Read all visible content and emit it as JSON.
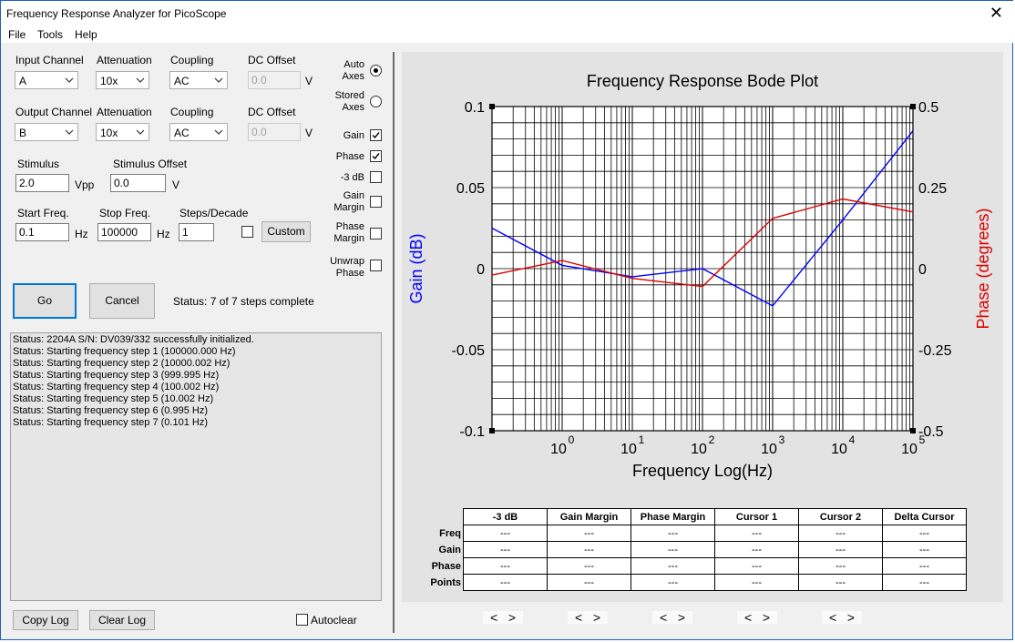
{
  "window": {
    "title": "Frequency Response Analyzer for PicoScope",
    "close": "✕"
  },
  "menu": [
    "File",
    "Tools",
    "Help"
  ],
  "input": {
    "channel_label": "Input Channel",
    "channel": "A",
    "atten_label": "Attenuation",
    "atten": "10x",
    "coupling_label": "Coupling",
    "coupling": "AC",
    "dc_label": "DC Offset",
    "dc": "0.0",
    "dc_unit": "V"
  },
  "output": {
    "channel_label": "Output Channel",
    "channel": "B",
    "atten_label": "Attenuation",
    "atten": "10x",
    "coupling_label": "Coupling",
    "coupling": "AC",
    "dc_label": "DC Offset",
    "dc": "0.0",
    "dc_unit": "V"
  },
  "stimulus": {
    "label": "Stimulus",
    "value": "2.0",
    "unit": "Vpp",
    "offset_label": "Stimulus Offset",
    "offset": "0.0",
    "offset_unit": "V"
  },
  "sweep": {
    "start_label": "Start Freq.",
    "start": "0.1",
    "start_unit": "Hz",
    "stop_label": "Stop Freq.",
    "stop": "100000",
    "stop_unit": "Hz",
    "steps_label": "Steps/Decade",
    "steps": "1",
    "custom_label": "Custom"
  },
  "actions": {
    "go": "Go",
    "cancel": "Cancel",
    "status": "Status:  7 of 7 steps complete"
  },
  "log": [
    "Status: 2204A S/N: DV039/332 successfully initialized.",
    "Status: Starting frequency step 1 (100000.000 Hz)",
    "Status: Starting frequency step 2 (10000.002 Hz)",
    "Status: Starting frequency step 3 (999.995 Hz)",
    "Status: Starting frequency step 4 (100.002 Hz)",
    "Status: Starting frequency step 5 (10.002 Hz)",
    "Status: Starting frequency step 6 (0.995 Hz)",
    "Status: Starting frequency step 7 (0.101 Hz)"
  ],
  "bottom": {
    "copy": "Copy Log",
    "clear": "Clear Log",
    "autoclear": "Autoclear"
  },
  "options": {
    "auto_axes": "Auto Axes",
    "stored_axes": "Stored Axes",
    "gain": "Gain",
    "phase": "Phase",
    "minus3db": "-3 dB",
    "gain_margin": "Gain Margin",
    "phase_margin": "Phase Margin",
    "unwrap_phase": "Unwrap Phase",
    "auto_axes_on": true,
    "gain_on": true,
    "phase_on": true
  },
  "chart_data": {
    "type": "line",
    "title": "Frequency Response Bode Plot",
    "xlabel": "Frequency Log(Hz)",
    "ylabel": "Gain (dB)",
    "y2label": "Phase (degrees)",
    "xscale": "log",
    "xlim": [
      0.1,
      100000
    ],
    "ylim": [
      -0.1,
      0.1
    ],
    "y2lim": [
      -0.5,
      0.5
    ],
    "xticks": [
      "0",
      "1",
      "2",
      "3",
      "4",
      "5"
    ],
    "yticks": [
      "0.1",
      "0.05",
      "0",
      "-0.05",
      "-0.1"
    ],
    "y2ticks": [
      "0.5",
      "0.25",
      "0",
      "-0.25",
      "-0.5"
    ],
    "grid": true,
    "series": [
      {
        "name": "Gain",
        "axis": "left",
        "color": "#0000ff",
        "x": [
          0.1,
          1,
          10,
          100,
          1000,
          10000,
          100000
        ],
        "y": [
          0.025,
          0.002,
          -0.005,
          0.0,
          -0.023,
          0.03,
          0.085
        ]
      },
      {
        "name": "Phase",
        "axis": "right",
        "color": "#dd0000",
        "x": [
          0.1,
          1,
          10,
          100,
          1000,
          10000,
          100000
        ],
        "y": [
          -0.02,
          0.025,
          -0.03,
          -0.055,
          0.155,
          0.215,
          0.175
        ]
      }
    ]
  },
  "results": {
    "columns": [
      "-3 dB",
      "Gain Margin",
      "Phase Margin",
      "Cursor 1",
      "Cursor 2",
      "Delta Cursor"
    ],
    "rows": [
      {
        "label": "Freq",
        "cells": [
          "---",
          "---",
          "---",
          "---",
          "---",
          "---"
        ]
      },
      {
        "label": "Gain",
        "cells": [
          "---",
          "---",
          "---",
          "---",
          "---",
          "---"
        ]
      },
      {
        "label": "Phase",
        "cells": [
          "---",
          "---",
          "---",
          "---",
          "---",
          "---"
        ]
      },
      {
        "label": "Points",
        "cells": [
          "---",
          "---",
          "---",
          "---",
          "---",
          "---"
        ]
      }
    ]
  },
  "nav": {
    "prev": "<",
    "next": ">"
  }
}
